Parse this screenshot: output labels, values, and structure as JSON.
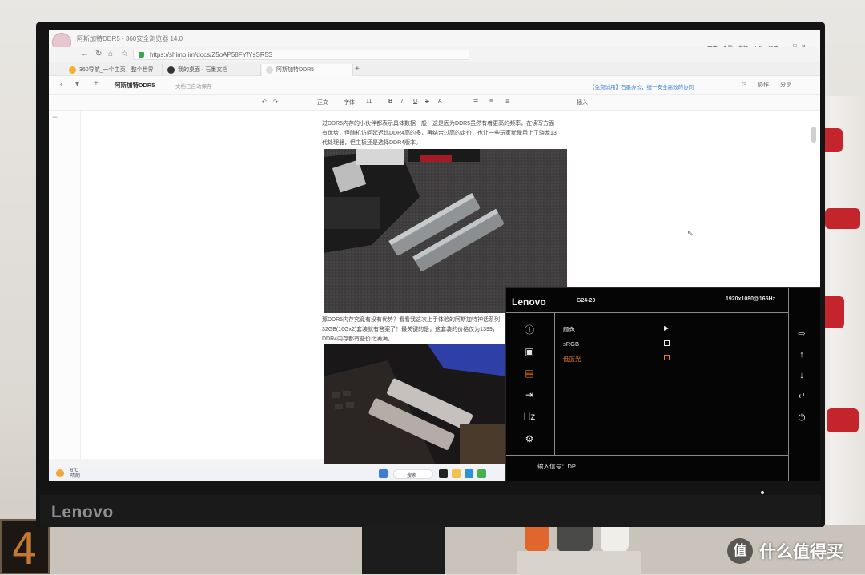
{
  "browser": {
    "window_title": "阿斯加特DDR5 - 360安全浏览器 14.0",
    "menu": [
      "文件",
      "查看",
      "收藏",
      "工具",
      "帮助"
    ],
    "url": "https://shimo.im/docs/Z5oAP58FYfYsSR5S",
    "tabs": [
      {
        "label": "360导航_一个主页，整个世界",
        "color": "#f2b12e"
      },
      {
        "label": "我的桌面 - 石墨文档",
        "color": "#333333"
      },
      {
        "label": "阿斯加特DDR5",
        "color": "#dddddd"
      }
    ]
  },
  "doc": {
    "title": "阿斯加特DDR5",
    "status": "文档已自动保存",
    "promo": "【免费试用】石墨办公，统一安全高效的协同",
    "toolbar_right": [
      "协作",
      "分享"
    ],
    "format": {
      "style": "正文",
      "font": "字体",
      "size": "11",
      "insert": "插入"
    },
    "para1_line1": "过DDR5内存的小伙伴都表示具体数据一般！这是因为DDR5虽然有着更高的频率，在读写方面",
    "para1_line2": "有优势，但随机访问延迟比DDR4高的多，再结合过高的定价，也让一些玩家犹豫用上了骁龙13",
    "para1_line3": "代处理器，但主板还是选择DDR4版本。",
    "para2_line1": "那DDR5内存究竟有没有优势？看看我这次上手体验的阿斯加特神话系列",
    "para2_line2": "32GB(16Gx2)套装就有答案了！最关键的是，这套装的价格仅为1399，",
    "para2_line3": "DDR4内存都有些价比满满。"
  },
  "taskbar": {
    "temp": "6°C",
    "weather": "晴朗",
    "search": "搜索"
  },
  "osd": {
    "brand": "Lenovo",
    "model": "G24-20",
    "resolution": "1920x1080@165Hz",
    "items": [
      "颜色",
      "sRGB",
      "低蓝光"
    ],
    "selected_item": "低蓝光",
    "signal": "输入信号：DP",
    "accent_color": "#ef7b2e"
  },
  "monitor": {
    "brand": "Lenovo"
  },
  "clock_digit": "4",
  "watermark": "什么值得买"
}
